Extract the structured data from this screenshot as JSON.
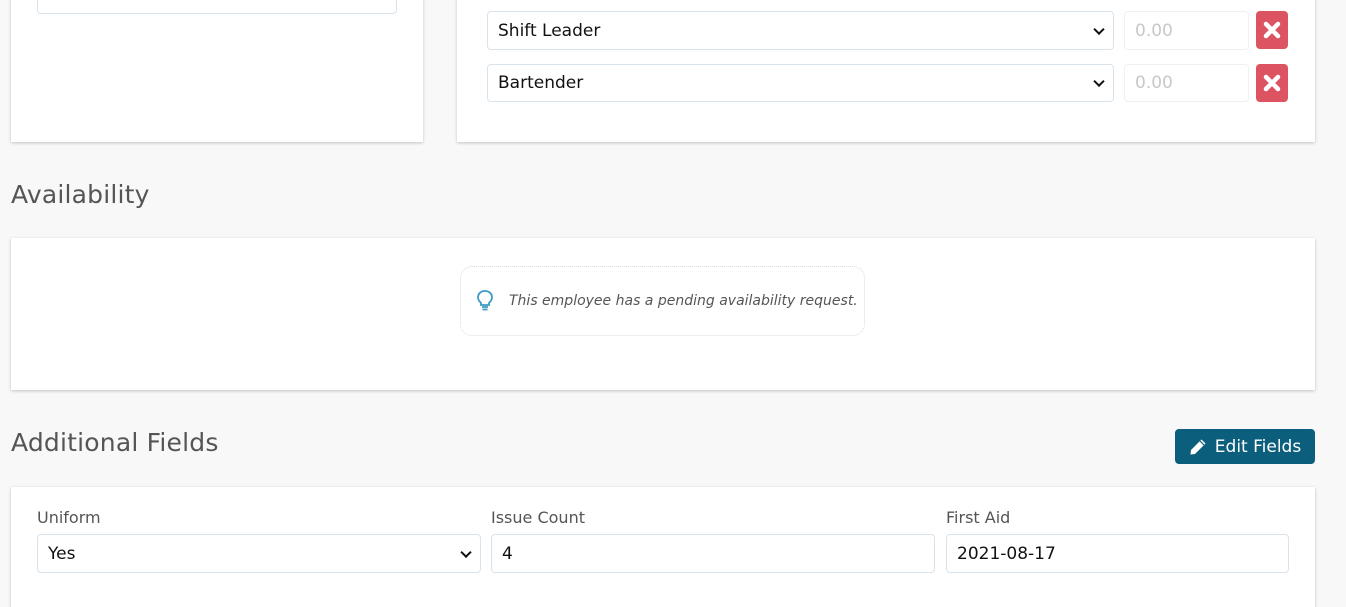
{
  "top_left_card": {
    "partial_input_value": ""
  },
  "positions": {
    "rows": [
      {
        "position": "Shift Leader",
        "rate_placeholder": "0.00",
        "remove_icon": "times-icon"
      },
      {
        "position": "Bartender",
        "rate_placeholder": "0.00",
        "remove_icon": "times-icon"
      }
    ]
  },
  "availability": {
    "title": "Availability",
    "notice_icon": "lightbulb-icon",
    "notice_text": "This employee has a pending availability request."
  },
  "additional_fields": {
    "title": "Additional Fields",
    "edit_button_label": "Edit Fields",
    "edit_button_icon": "pencil-icon",
    "fields": [
      {
        "label": "Uniform",
        "value": "Yes",
        "type": "select"
      },
      {
        "label": "Issue Count",
        "value": "4",
        "type": "text"
      },
      {
        "label": "First Aid",
        "value": "2021-08-17",
        "type": "text"
      }
    ]
  },
  "colors": {
    "danger": "#dc5462",
    "primary": "#0b5f7c",
    "info_icon": "#3d9bc4"
  }
}
